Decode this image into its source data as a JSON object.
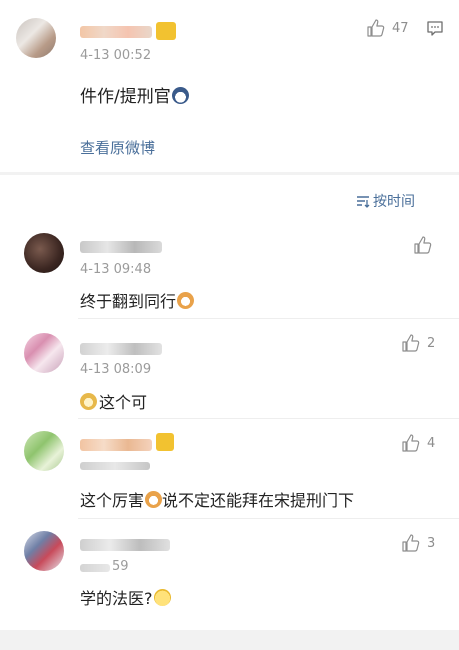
{
  "post": {
    "time": "4-13 00:52",
    "text": "件作/提刑官",
    "likes": "47",
    "view_original": "查看原微博"
  },
  "sort": {
    "label": "按时间"
  },
  "comments": [
    {
      "time": "4-13 09:48",
      "text": "终于翻到同行",
      "likes": ""
    },
    {
      "time": "4-13 08:09",
      "text": "这个可",
      "likes": "2"
    },
    {
      "time": "",
      "text_a": "这个厉害",
      "text_b": "说不定还能拜在宋提刑门下",
      "likes": "4"
    },
    {
      "time": "59",
      "text": "学的法医?",
      "likes": "3"
    }
  ]
}
